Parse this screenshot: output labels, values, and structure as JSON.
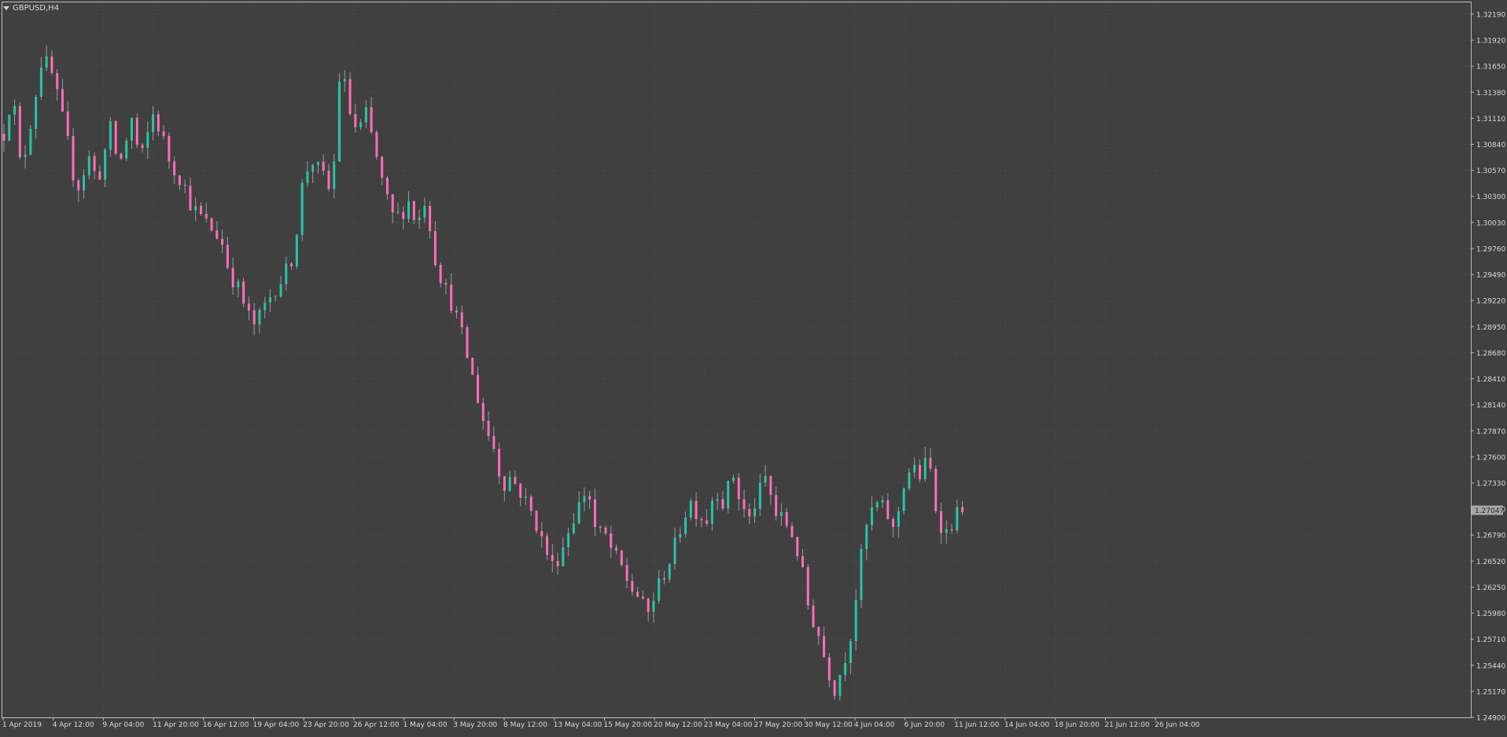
{
  "window": {
    "symbol_title": "GBPUSD,H4"
  },
  "colors": {
    "background": "#404040",
    "frame": "#bdbdbd",
    "grid": "#4a4a4a",
    "text": "#d9d9d9",
    "bull": "#26c6a0",
    "bear": "#ff6fb2",
    "wick": "#9a9a9a",
    "price_tag_bg": "#a6a6a6",
    "price_tag_text": "#2f2f2f"
  },
  "chart_data": {
    "type": "candlestick",
    "title": "GBPUSD,H4",
    "grid": true,
    "y_axis_position": "right",
    "ylim": [
      1.249,
      1.3232
    ],
    "y_ticks": [
      "1.32190",
      "1.31920",
      "1.31650",
      "1.31380",
      "1.31110",
      "1.30840",
      "1.30570",
      "1.30300",
      "1.30030",
      "1.29760",
      "1.29490",
      "1.29220",
      "1.28950",
      "1.28680",
      "1.28410",
      "1.28140",
      "1.27870",
      "1.27600",
      "1.27330",
      "1.27060",
      "1.26790",
      "1.26520",
      "1.26250",
      "1.25980",
      "1.25710",
      "1.25440",
      "1.25170",
      "1.24900"
    ],
    "x_ticks": [
      "1 Apr 2019",
      "4 Apr 12:00",
      "9 Apr 04:00",
      "11 Apr 20:00",
      "16 Apr 12:00",
      "19 Apr 04:00",
      "23 Apr 20:00",
      "26 Apr 12:00",
      "1 May 04:00",
      "3 May 20:00",
      "8 May 12:00",
      "13 May 04:00",
      "15 May 20:00",
      "20 May 12:00",
      "23 May 04:00",
      "27 May 20:00",
      "30 May 12:00",
      "4 Jun 04:00",
      "6 Jun 20:00",
      "11 Jun 12:00",
      "14 Jun 04:00",
      "18 Jun 20:00",
      "21 Jun 12:00",
      "26 Jun 04:00"
    ],
    "current_price": "1.27047",
    "price_path": [
      [
        0,
        1.3095
      ],
      [
        2,
        1.314
      ],
      [
        4,
        1.3055
      ],
      [
        6,
        1.31
      ],
      [
        9,
        1.3175
      ],
      [
        11,
        1.316
      ],
      [
        13,
        1.3125
      ],
      [
        15,
        1.3085
      ],
      [
        17,
        1.3035
      ],
      [
        20,
        1.307
      ],
      [
        22,
        1.3045
      ],
      [
        25,
        1.31
      ],
      [
        27,
        1.306
      ],
      [
        30,
        1.311
      ],
      [
        32,
        1.3065
      ],
      [
        35,
        1.3115
      ],
      [
        37,
        1.3095
      ],
      [
        39,
        1.3065
      ],
      [
        42,
        1.3045
      ],
      [
        44,
        1.302
      ],
      [
        47,
        1.3005
      ],
      [
        49,
        1.2995
      ],
      [
        51,
        1.2985
      ],
      [
        53,
        1.295
      ],
      [
        55,
        1.2935
      ],
      [
        57,
        1.291
      ],
      [
        59,
        1.2895
      ],
      [
        61,
        1.2915
      ],
      [
        63,
        1.293
      ],
      [
        66,
        1.295
      ],
      [
        68,
        1.297
      ],
      [
        70,
        1.304
      ],
      [
        72,
        1.307
      ],
      [
        75,
        1.305
      ],
      [
        77,
        1.303
      ],
      [
        79,
        1.317
      ],
      [
        81,
        1.312
      ],
      [
        83,
        1.3095
      ],
      [
        85,
        1.3115
      ],
      [
        87,
        1.308
      ],
      [
        89,
        1.304
      ],
      [
        91,
        1.301
      ],
      [
        93,
        1.301
      ],
      [
        95,
        1.3025
      ],
      [
        97,
        1.3
      ],
      [
        99,
        1.303
      ],
      [
        101,
        1.297
      ],
      [
        103,
        1.294
      ],
      [
        105,
        1.292
      ],
      [
        107,
        1.2895
      ],
      [
        109,
        1.286
      ],
      [
        111,
        1.2825
      ],
      [
        113,
        1.279
      ],
      [
        115,
        1.277
      ],
      [
        117,
        1.273
      ],
      [
        119,
        1.274
      ],
      [
        121,
        1.2725
      ],
      [
        123,
        1.271
      ],
      [
        125,
        1.269
      ],
      [
        127,
        1.2665
      ],
      [
        129,
        1.2645
      ],
      [
        131,
        1.2665
      ],
      [
        133,
        1.269
      ],
      [
        135,
        1.271
      ],
      [
        137,
        1.273
      ],
      [
        139,
        1.268
      ],
      [
        141,
        1.268
      ],
      [
        143,
        1.266
      ],
      [
        145,
        1.2645
      ],
      [
        147,
        1.2625
      ],
      [
        149,
        1.2615
      ],
      [
        151,
        1.2595
      ],
      [
        153,
        1.262
      ],
      [
        155,
        1.264
      ],
      [
        157,
        1.266
      ],
      [
        159,
        1.269
      ],
      [
        161,
        1.2715
      ],
      [
        163,
        1.27
      ],
      [
        165,
        1.2695
      ],
      [
        167,
        1.273
      ],
      [
        169,
        1.271
      ],
      [
        171,
        1.2745
      ],
      [
        173,
        1.271
      ],
      [
        175,
        1.2695
      ],
      [
        177,
        1.272
      ],
      [
        179,
        1.274
      ],
      [
        181,
        1.27
      ],
      [
        183,
        1.2695
      ],
      [
        185,
        1.268
      ],
      [
        187,
        1.265
      ],
      [
        189,
        1.26
      ],
      [
        191,
        1.258
      ],
      [
        193,
        1.2545
      ],
      [
        195,
        1.252
      ],
      [
        197,
        1.2545
      ],
      [
        199,
        1.258
      ],
      [
        201,
        1.265
      ],
      [
        203,
        1.27
      ],
      [
        205,
        1.271
      ],
      [
        207,
        1.2705
      ],
      [
        209,
        1.268
      ],
      [
        211,
        1.273
      ],
      [
        213,
        1.275
      ],
      [
        215,
        1.274
      ],
      [
        217,
        1.276
      ],
      [
        219,
        1.27
      ],
      [
        221,
        1.268
      ],
      [
        223,
        1.2695
      ],
      [
        225,
        1.271
      ]
    ]
  }
}
